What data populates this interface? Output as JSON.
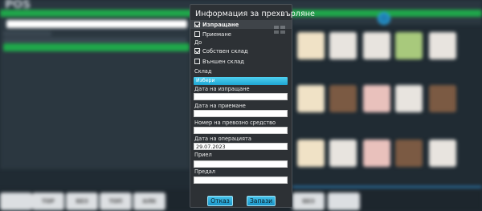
{
  "background": {
    "logo": "POS",
    "bottom_buttons": [
      "",
      "ТОР",
      "БЕЗ",
      "ТОП",
      "АЛК",
      "",
      "",
      "",
      "",
      "БЕЗ",
      ""
    ]
  },
  "dialog": {
    "title": "Информация за прехвърляне",
    "options": [
      {
        "label": "Изпращане",
        "checked": true,
        "bold": true
      },
      {
        "label": "Приемане",
        "checked": false,
        "bold": false
      }
    ],
    "to_label": "До",
    "to_options": [
      {
        "label": "Собствен склад",
        "checked": true
      },
      {
        "label": "Външен склад",
        "checked": false
      }
    ],
    "warehouse_label": "Склад",
    "warehouse_select": "Избери",
    "send_date_label": "Дата на изпращане",
    "send_date_value": "",
    "receive_date_label": "Дата на приемане",
    "receive_date_value": "",
    "vehicle_label": "Номер на превозно средство",
    "vehicle_value": "",
    "operation_date_label": "Дата на операцията",
    "operation_date_value": "29.07.2023",
    "received_by_label": "Приел",
    "received_by_value": "",
    "handed_by_label": "Предал",
    "handed_by_value": "",
    "cancel_label": "Отказ",
    "save_label": "Запази"
  },
  "colors": {
    "dialog_bg": "#2d3135",
    "accent": "#1fa6d3",
    "green": "#1fa84a"
  }
}
